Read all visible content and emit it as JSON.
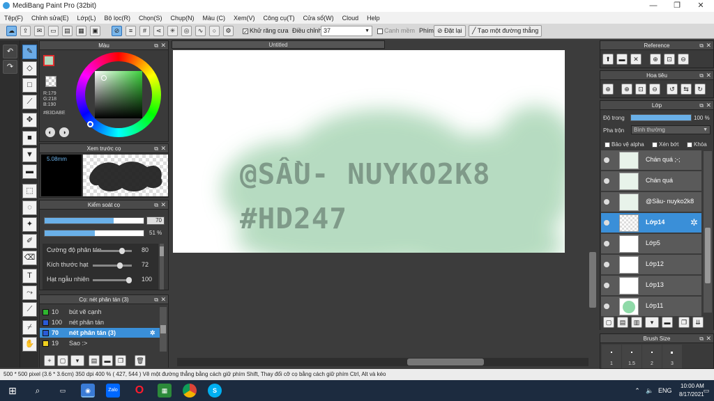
{
  "window": {
    "title": "MediBang Paint Pro (32bit)",
    "minimize": "—",
    "maximize": "❐",
    "close": "✕"
  },
  "menu": [
    "Tệp(F)",
    "Chỉnh sửa(E)",
    "Lớp(L)",
    "Bộ lọc(R)",
    "Chọn(S)",
    "Chụp(N)",
    "Màu (C)",
    "Xem(V)",
    "Công cụ(T)",
    "Cửa sổ(W)",
    "Cloud",
    "Help"
  ],
  "toolbar": {
    "antialias_label": "Khử răng cưa",
    "antialias_checked": true,
    "correction_label": "Điều chỉnh",
    "correction_value": "37",
    "smooth_label": "Canh mềm",
    "smooth_checked": false,
    "key_label": "Phím",
    "reset_label": "Đặt lại",
    "straight_line_label": "Tạo một đường thẳng"
  },
  "color_panel": {
    "title": "Màu",
    "r": "R:179",
    "g": "G:218",
    "b": "B:190",
    "hex": "#B3DABE",
    "current_color": "#b3dabe"
  },
  "brush_preview": {
    "title": "Xem trước cọ",
    "size": "5.08mm"
  },
  "brush_control": {
    "title": "Kiểm soát cọ",
    "size_value": "70",
    "size_fraction": 0.7,
    "opacity_value": "51 %",
    "opacity_fraction": 0.51,
    "params": [
      {
        "label": "Cường độ phân tán",
        "value": "80",
        "fraction": 0.8
      },
      {
        "label": "Kích thước hạt",
        "value": "72",
        "fraction": 0.72
      },
      {
        "label": "Hạt ngẫu nhiên",
        "value": "100",
        "fraction": 1.0
      }
    ]
  },
  "brush_list": {
    "title": "Cọ: nét phân tán (3)",
    "items": [
      {
        "size": "10",
        "name": "bút vẽ cạnh",
        "color": "#2fb52f",
        "selected": false
      },
      {
        "size": "100",
        "name": "nét phân tán",
        "color": "#2a5bd6",
        "selected": false
      },
      {
        "size": "70",
        "name": "nét phân tán (3)",
        "color": "#2a5bd6",
        "selected": true
      },
      {
        "size": "19",
        "name": "Sao :>",
        "color": "#f0d020",
        "selected": false
      }
    ]
  },
  "canvas": {
    "tab_title": "Untitled",
    "line1": "@SẦU- NUYKO2K8",
    "line2": "#HD247"
  },
  "reference": {
    "title": "Reference"
  },
  "navigator": {
    "title": "Hoa tiêu"
  },
  "layers_panel": {
    "title": "Lớp",
    "opacity_label": "Độ trong",
    "opacity_value": "100 %",
    "opacity_fraction": 1.0,
    "blend_label": "Pha trộn",
    "blend_value": "Bình thường",
    "protect_alpha": "Bảo vệ alpha",
    "clipping": "Xén bớt",
    "lock": "Khóa",
    "layers": [
      {
        "name": "Chán quá ;-;",
        "selected": false
      },
      {
        "name": "Chán quá",
        "selected": false
      },
      {
        "name": "@Sầu- nuyko2k8",
        "selected": false
      },
      {
        "name": "Lớp14",
        "selected": true
      },
      {
        "name": "Lớp5",
        "selected": false
      },
      {
        "name": "Lớp12",
        "selected": false
      },
      {
        "name": "Lớp13",
        "selected": false
      },
      {
        "name": "Lớp11",
        "selected": false
      }
    ]
  },
  "brush_size": {
    "title": "Brush Size",
    "sizes": [
      "1",
      "1.5",
      "2",
      "3"
    ]
  },
  "status": "500 * 500 pixel   (3.6 * 3.6cm)   350 dpi   400 %   ( 427, 544 )   Vẽ một đường thẳng bằng cách giữ phím Shift, Thay đổi cỡ cọ bằng cách giữ phím Ctrl, Alt và kéo",
  "taskbar": {
    "lang": "ENG",
    "time": "10:00 AM",
    "date": "8/17/2021",
    "zalo": "Zalo"
  }
}
